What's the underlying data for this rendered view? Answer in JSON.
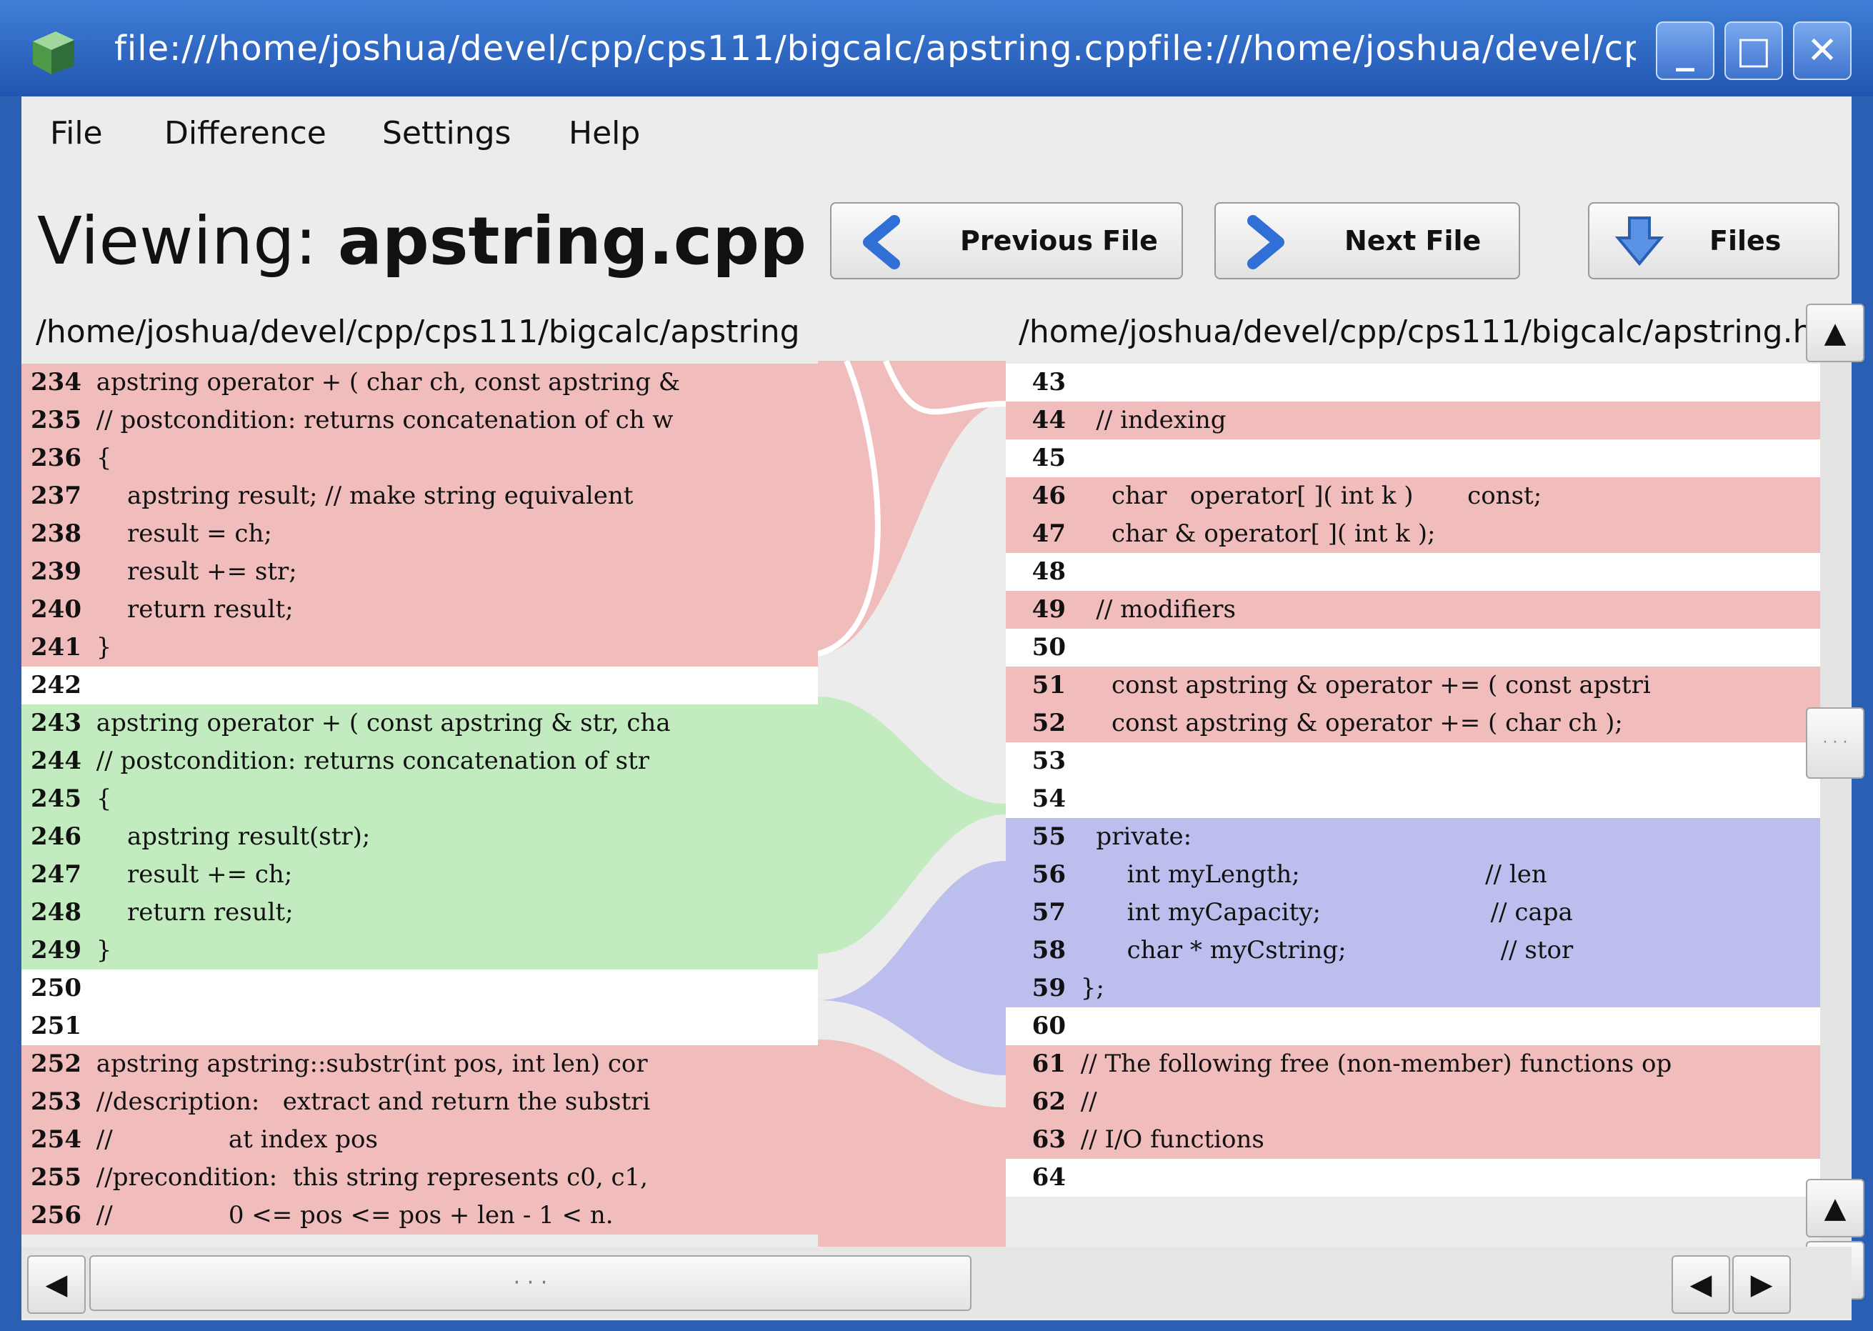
{
  "window": {
    "title": "file:///home/joshua/devel/cpp/cps111/bigcalc/apstring.cppfile:///home/joshua/devel/cpp",
    "minimize_label": "_",
    "maximize_label": "□",
    "close_label": "✕"
  },
  "menu": {
    "file": "File",
    "difference": "Difference",
    "settings": "Settings",
    "help": "Help"
  },
  "toolbar": {
    "viewing_prefix": "Viewing: ",
    "viewing_file": "apstring.cpp",
    "previous_file": "Previous File",
    "next_file": "Next File",
    "files": "Files"
  },
  "left": {
    "path": "/home/joshua/devel/cpp/cps111/bigcalc/apstring",
    "lines": [
      {
        "n": "234",
        "text": " apstring operator + ( char ch, const apstring &",
        "color": "#f0bcbc"
      },
      {
        "n": "235",
        "text": " // postcondition: returns concatenation of ch w",
        "color": "#f0bcbc"
      },
      {
        "n": "236",
        "text": " {",
        "color": "#f0bcbc"
      },
      {
        "n": "237",
        "text": "     apstring result; // make string equivalent",
        "color": "#f0bcbc"
      },
      {
        "n": "238",
        "text": "     result = ch;",
        "color": "#f0bcbc"
      },
      {
        "n": "239",
        "text": "     result += str;",
        "color": "#f0bcbc"
      },
      {
        "n": "240",
        "text": "     return result;",
        "color": "#f0bcbc"
      },
      {
        "n": "241",
        "text": " }",
        "color": "#f0bcbc"
      },
      {
        "n": "242",
        "text": "",
        "color": "#ffffff"
      },
      {
        "n": "243",
        "text": " apstring operator + ( const apstring & str, cha",
        "color": "#c2ecc0"
      },
      {
        "n": "244",
        "text": " // postcondition: returns concatenation of str",
        "color": "#c2ecc0"
      },
      {
        "n": "245",
        "text": " {",
        "color": "#c2ecc0"
      },
      {
        "n": "246",
        "text": "     apstring result(str);",
        "color": "#c2ecc0"
      },
      {
        "n": "247",
        "text": "     result += ch;",
        "color": "#c2ecc0"
      },
      {
        "n": "248",
        "text": "     return result;",
        "color": "#c2ecc0"
      },
      {
        "n": "249",
        "text": " }",
        "color": "#c2ecc0"
      },
      {
        "n": "250",
        "text": "",
        "color": "#ffffff"
      },
      {
        "n": "251",
        "text": "",
        "color": "#ffffff"
      },
      {
        "n": "252",
        "text": " apstring apstring::substr(int pos, int len) cor",
        "color": "#f0bcbc"
      },
      {
        "n": "253",
        "text": " //description:   extract and return the substri",
        "color": "#f0bcbc"
      },
      {
        "n": "254",
        "text": " //               at index pos",
        "color": "#f0bcbc"
      },
      {
        "n": "255",
        "text": " //precondition:  this string represents c0, c1,",
        "color": "#f0bcbc"
      },
      {
        "n": "256",
        "text": " //               0 <= pos <= pos + len - 1 < n.",
        "color": "#f0bcbc"
      }
    ]
  },
  "right": {
    "path": "/home/joshua/devel/cpp/cps111/bigcalc/apstring.h",
    "lines": [
      {
        "n": "43",
        "text": "",
        "color": "#ffffff"
      },
      {
        "n": "44",
        "text": "   // indexing",
        "color": "#f0bcbc"
      },
      {
        "n": "45",
        "text": "",
        "color": "#ffffff"
      },
      {
        "n": "46",
        "text": "     char   operator[ ]( int k )       const;",
        "color": "#f0bcbc"
      },
      {
        "n": "47",
        "text": "     char & operator[ ]( int k );",
        "color": "#f0bcbc"
      },
      {
        "n": "48",
        "text": "",
        "color": "#ffffff"
      },
      {
        "n": "49",
        "text": "   // modifiers",
        "color": "#f0bcbc"
      },
      {
        "n": "50",
        "text": "",
        "color": "#ffffff"
      },
      {
        "n": "51",
        "text": "     const apstring & operator += ( const apstri",
        "color": "#f0bcbc"
      },
      {
        "n": "52",
        "text": "     const apstring & operator += ( char ch );",
        "color": "#f0bcbc"
      },
      {
        "n": "53",
        "text": "",
        "color": "#ffffff"
      },
      {
        "n": "54",
        "text": "",
        "color": "#ffffff"
      },
      {
        "n": "55",
        "text": "   private:",
        "color": "#bcbeee"
      },
      {
        "n": "56",
        "text": "       int myLength;                        // len",
        "color": "#bcbeee"
      },
      {
        "n": "57",
        "text": "       int myCapacity;                      // capa",
        "color": "#bcbeee"
      },
      {
        "n": "58",
        "text": "       char * myCstring;                    // stor",
        "color": "#bcbeee"
      },
      {
        "n": "59",
        "text": " };",
        "color": "#bcbeee"
      },
      {
        "n": "60",
        "text": "",
        "color": "#ffffff"
      },
      {
        "n": "61",
        "text": " // The following free (non-member) functions op",
        "color": "#f0bcbc"
      },
      {
        "n": "62",
        "text": " //",
        "color": "#f0bcbc"
      },
      {
        "n": "63",
        "text": " // I/O functions",
        "color": "#f0bcbc"
      },
      {
        "n": "64",
        "text": "",
        "color": "#ffffff"
      }
    ]
  },
  "scroll": {
    "up_arrow": "▲",
    "down_arrow": "▼",
    "left_arrow": "◀",
    "right_arrow": "▶",
    "grip": "· · ·"
  },
  "colors": {
    "removed": "#f0bcbc",
    "added": "#c2ecc0",
    "changed": "#bcbeee",
    "unchanged": "#ffffff",
    "titlebar": "#2a5fb4"
  }
}
